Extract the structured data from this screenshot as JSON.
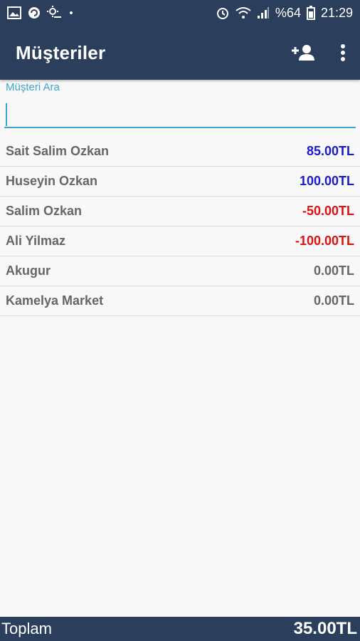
{
  "status_bar": {
    "battery_percent": "%64",
    "time": "21:29",
    "left_icons": [
      "image-icon",
      "sync-icon",
      "weather-icon",
      "dot-icon"
    ],
    "right_icons": [
      "alarm-icon",
      "wifi-icon",
      "signal-icon",
      "battery-icon"
    ]
  },
  "app_bar": {
    "title": "Müşteriler",
    "actions": [
      "add-person-icon",
      "more-vert-icon"
    ]
  },
  "search": {
    "label": "Müşteri Ara",
    "value": "",
    "placeholder": ""
  },
  "customers": [
    {
      "name": "Sait Salim Ozkan",
      "amount": "85.00TL",
      "color": "#1a1acc"
    },
    {
      "name": "Huseyin Ozkan",
      "amount": "100.00TL",
      "color": "#1a1acc"
    },
    {
      "name": "Salim Ozkan",
      "amount": "-50.00TL",
      "color": "#dd1111"
    },
    {
      "name": "Ali Yilmaz",
      "amount": "-100.00TL",
      "color": "#dd1111"
    },
    {
      "name": "Akugur",
      "amount": "0.00TL",
      "color": "#666666"
    },
    {
      "name": "Kamelya Market",
      "amount": "0.00TL",
      "color": "#666666"
    }
  ],
  "footer": {
    "label": "Toplam",
    "total": "35.00TL"
  },
  "colors": {
    "primary": "#2b3e5c",
    "accent": "#3aa7d0",
    "positive": "#1a1acc",
    "negative": "#dd1111",
    "neutral": "#666666"
  }
}
